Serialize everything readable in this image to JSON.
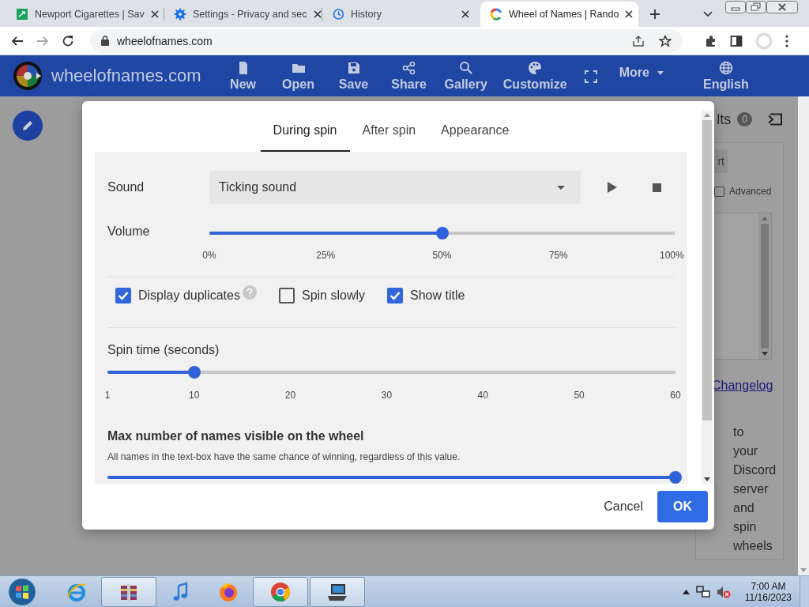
{
  "browser": {
    "tabs": [
      {
        "kind": "page",
        "title": "Newport Cigarettes | Sav",
        "selected": false
      },
      {
        "kind": "settings",
        "title": "Settings - Privacy and sec",
        "selected": false
      },
      {
        "kind": "history",
        "title": "History",
        "selected": false
      },
      {
        "kind": "wheel",
        "title": "Wheel of Names | Rando",
        "selected": true
      }
    ],
    "address": "wheelofnames.com"
  },
  "app_header": {
    "brand": "wheelofnames.com",
    "menu": [
      {
        "kind": "file",
        "label": "New"
      },
      {
        "kind": "folder",
        "label": "Open"
      },
      {
        "kind": "save",
        "label": "Save"
      },
      {
        "kind": "share",
        "label": "Share"
      },
      {
        "kind": "search",
        "label": "Gallery"
      },
      {
        "kind": "palette",
        "label": "Customize"
      },
      {
        "kind": "fullscreen"
      },
      {
        "kind": "more",
        "label": "More"
      },
      {
        "kind": "globe",
        "label": "English"
      }
    ]
  },
  "side_panel": {
    "results_label": "lts",
    "results_count": "0",
    "button": "rt",
    "advanced": {
      "label": "Advanced",
      "checked": false
    },
    "link": "Changelog",
    "text": "to your Discord server and spin wheels"
  },
  "dialog": {
    "tabs": [
      {
        "label": "During spin",
        "selected": true
      },
      {
        "label": "After spin",
        "selected": false
      },
      {
        "label": "Appearance",
        "selected": false
      }
    ],
    "sound": {
      "label": "Sound",
      "value": "Ticking sound"
    },
    "volume": {
      "label": "Volume",
      "level": 0.5,
      "ticks": [
        "0%",
        "25%",
        "50%",
        "75%",
        "100%"
      ]
    },
    "options": [
      {
        "label": "Display duplicates",
        "checked": true,
        "help": true
      },
      {
        "label": "Spin slowly",
        "checked": false
      },
      {
        "label": "Show title",
        "checked": true
      }
    ],
    "spin_time": {
      "label": "Spin time (seconds)",
      "level": 0.1525,
      "ticks": [
        "1",
        "10",
        "20",
        "30",
        "40",
        "50",
        "60"
      ]
    },
    "max_names": {
      "title": "Max number of names visible on the wheel",
      "note": "All names in the text-box have the same chance of winning, regardless of this value.",
      "level": 1
    },
    "buttons": {
      "cancel": "Cancel",
      "ok": "OK"
    }
  },
  "taskbar": {
    "apps": [
      {
        "kind": "ie",
        "running": false
      },
      {
        "kind": "archive",
        "running": true
      },
      {
        "kind": "music",
        "running": false
      },
      {
        "kind": "firefox",
        "running": false
      },
      {
        "kind": "chrome",
        "running": true
      },
      {
        "kind": "laptop",
        "running": true
      }
    ],
    "time": "7:00 AM",
    "date": "11/16/2023"
  }
}
